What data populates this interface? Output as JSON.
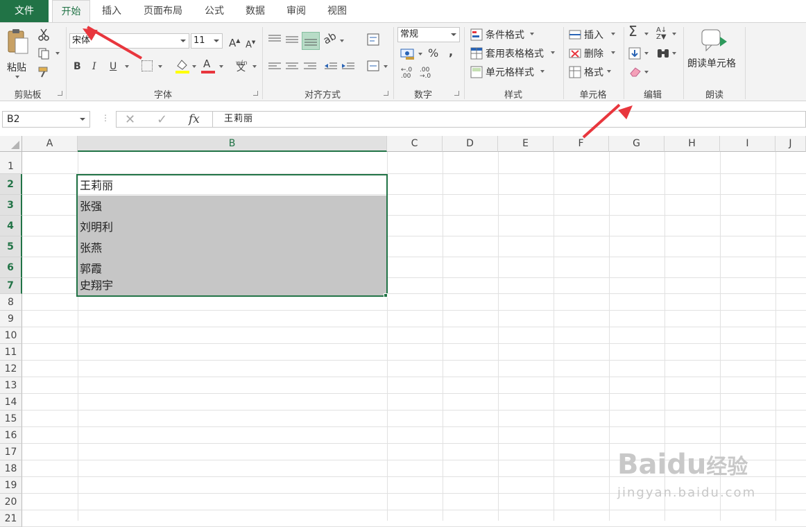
{
  "tabs": {
    "file": "文件",
    "home": "开始",
    "insert": "插入",
    "layout": "页面布局",
    "formulas": "公式",
    "data": "数据",
    "review": "审阅",
    "view": "视图"
  },
  "clipboard": {
    "paste": "粘贴",
    "label": "剪贴板"
  },
  "font": {
    "name": "宋体",
    "size": "11",
    "bold": "B",
    "italic": "I",
    "underline": "U",
    "grow": "A",
    "shrink": "A",
    "color_letter": "A",
    "phonetic": "wén",
    "phonetic2": "文",
    "label": "字体"
  },
  "alignment": {
    "label": "对齐方式"
  },
  "number": {
    "format": "常规",
    "percent": "%",
    "comma": ",",
    "inc": ".0→.00",
    "dec": ".00→.0",
    "label": "数字"
  },
  "styles": {
    "cond": "条件格式",
    "table": "套用表格格式",
    "cell": "单元格样式",
    "label": "样式"
  },
  "cells": {
    "insert": "插入",
    "delete": "删除",
    "format": "格式",
    "label": "单元格"
  },
  "editing": {
    "sum": "Σ",
    "label": "编辑"
  },
  "read": {
    "button": "朗读单元格",
    "label": "朗读"
  },
  "formula_bar": {
    "name_box": "B2",
    "cancel": "✕",
    "enter": "✓",
    "fx": "fx",
    "content": "王莉丽"
  },
  "columns": [
    "A",
    "B",
    "C",
    "D",
    "E",
    "F",
    "G",
    "H",
    "I",
    "J"
  ],
  "rows": [
    "1",
    "2",
    "3",
    "4",
    "5",
    "6",
    "7",
    "8",
    "9",
    "10",
    "11",
    "12",
    "13",
    "14",
    "15",
    "16",
    "17",
    "18",
    "19",
    "20",
    "21"
  ],
  "cells_b": [
    "王莉丽",
    "张强",
    "刘明利",
    "张燕",
    "郭霞",
    "史翔宇"
  ],
  "watermark": {
    "brand": "Bai",
    "paw": "du",
    "suffix": "经验",
    "url": "jingyan.baidu.com"
  },
  "colors": {
    "accent": "#217346",
    "arrow": "#e8363d",
    "selection": "#c6c6c6"
  }
}
